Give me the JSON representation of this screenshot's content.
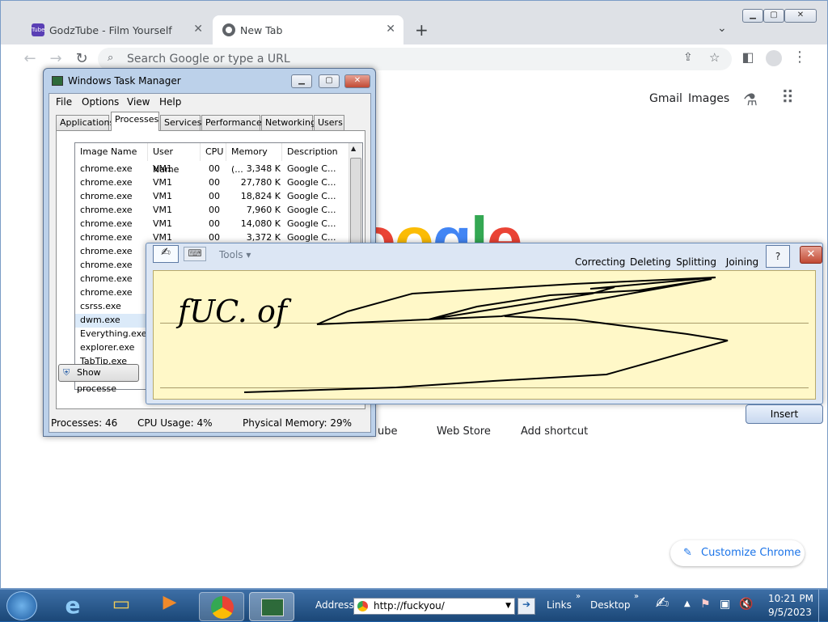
{
  "browser": {
    "tabs": [
      {
        "title": "GodzTube - Film Yourself",
        "active": false
      },
      {
        "title": "New Tab",
        "active": true
      }
    ],
    "new_tab_symbol": "+",
    "omnibox_placeholder": "Search Google or type a URL",
    "top_links": [
      "Gmail",
      "Images"
    ],
    "logo_text": "oogle",
    "shortcuts": [
      "ube",
      "Web Store",
      "Add shortcut"
    ],
    "customize_label": "Customize Chrome"
  },
  "task_manager": {
    "title": "Windows Task Manager",
    "menu": [
      "File",
      "Options",
      "View",
      "Help"
    ],
    "tabs": [
      "Applications",
      "Processes",
      "Services",
      "Performance",
      "Networking",
      "Users"
    ],
    "selected_tab": "Processes",
    "columns": [
      "Image Name",
      "User Name",
      "CPU",
      "Memory (...",
      "Description"
    ],
    "rows": [
      {
        "name": "chrome.exe",
        "user": "VM1",
        "cpu": "00",
        "mem": "3,348 K",
        "desc": "Google C..."
      },
      {
        "name": "chrome.exe",
        "user": "VM1",
        "cpu": "00",
        "mem": "27,780 K",
        "desc": "Google C..."
      },
      {
        "name": "chrome.exe",
        "user": "VM1",
        "cpu": "00",
        "mem": "18,824 K",
        "desc": "Google C..."
      },
      {
        "name": "chrome.exe",
        "user": "VM1",
        "cpu": "00",
        "mem": "7,960 K",
        "desc": "Google C..."
      },
      {
        "name": "chrome.exe",
        "user": "VM1",
        "cpu": "00",
        "mem": "14,080 K",
        "desc": "Google C..."
      },
      {
        "name": "chrome.exe",
        "user": "VM1",
        "cpu": "00",
        "mem": "3,372 K",
        "desc": "Google C..."
      },
      {
        "name": "chrome.exe",
        "user": "",
        "cpu": "",
        "mem": "",
        "desc": ""
      },
      {
        "name": "chrome.exe",
        "user": "",
        "cpu": "",
        "mem": "",
        "desc": ""
      },
      {
        "name": "chrome.exe",
        "user": "",
        "cpu": "",
        "mem": "",
        "desc": ""
      },
      {
        "name": "chrome.exe",
        "user": "",
        "cpu": "",
        "mem": "",
        "desc": ""
      },
      {
        "name": "csrss.exe",
        "user": "",
        "cpu": "",
        "mem": "",
        "desc": ""
      },
      {
        "name": "dwm.exe",
        "user": "",
        "cpu": "",
        "mem": "",
        "desc": ""
      },
      {
        "name": "Everything.exe",
        "user": "",
        "cpu": "",
        "mem": "",
        "desc": ""
      },
      {
        "name": "explorer.exe",
        "user": "",
        "cpu": "",
        "mem": "",
        "desc": ""
      },
      {
        "name": "TabTip.exe",
        "user": "",
        "cpu": "",
        "mem": "",
        "desc": ""
      }
    ],
    "selected_row_index": 11,
    "show_processes_label": "Show processe",
    "status": {
      "processes": "Processes: 46",
      "cpu": "CPU Usage: 4%",
      "memory": "Physical Memory: 29%"
    }
  },
  "input_panel": {
    "tools_label": "Tools",
    "actions": [
      "Correcting",
      "Deleting",
      "Splitting",
      "Joining"
    ],
    "handwriting_text": "fUC. of",
    "insert_label": "Insert"
  },
  "taskbar": {
    "address_label": "Address",
    "address_value": "http://fuckyou/",
    "links_label": "Links",
    "desktop_label": "Desktop",
    "time": "10:21 PM",
    "date": "9/5/2023"
  }
}
